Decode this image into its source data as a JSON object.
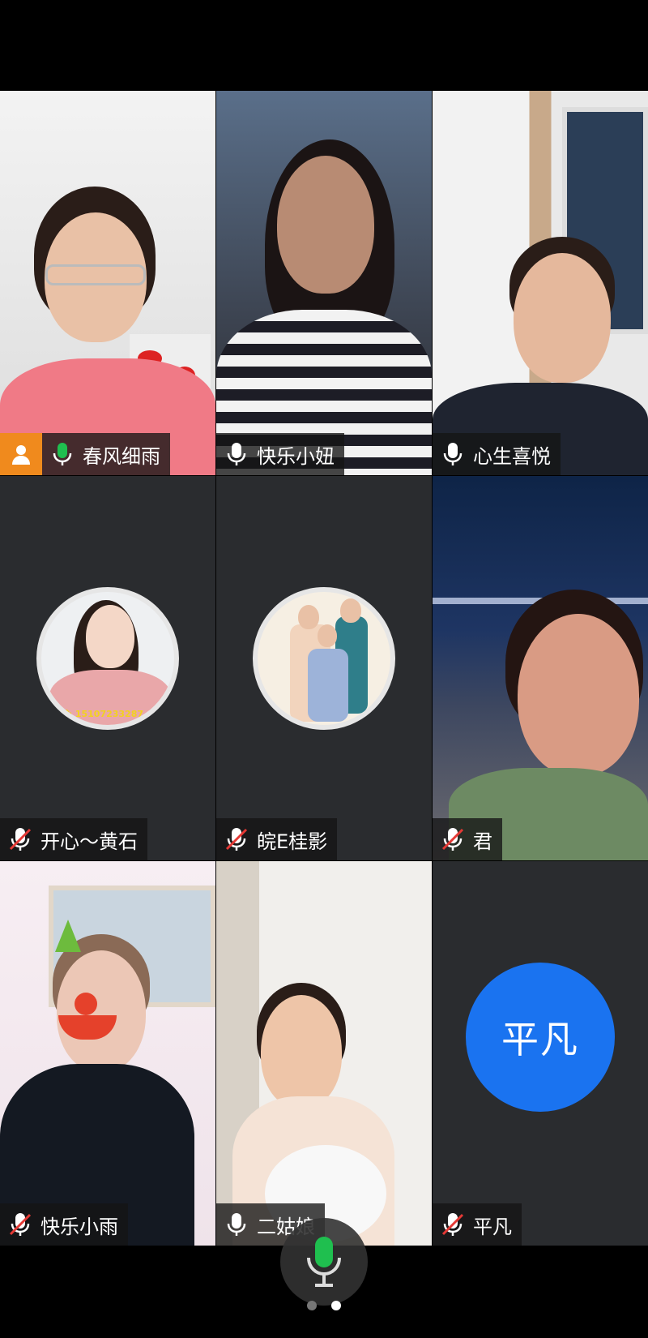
{
  "participants": [
    {
      "name": "春风细雨",
      "muted": false,
      "host": true
    },
    {
      "name": "快乐小妞",
      "muted": false
    },
    {
      "name": "心生喜悦",
      "muted": false
    },
    {
      "name": "开心～黄石",
      "muted": true
    },
    {
      "name": "皖E桂影",
      "muted": true
    },
    {
      "name": "君",
      "muted": true
    },
    {
      "name": "快乐小雨",
      "muted": true
    },
    {
      "name": "二姑娘",
      "muted": false
    },
    {
      "name": "平凡",
      "muted": true,
      "avatar_text": "平凡"
    }
  ],
  "avatar_overlay_text": "开心 15107233287",
  "pager": {
    "pages": 2,
    "current": 2
  },
  "colors": {
    "active_border": "#1fbf4f",
    "host_badge": "#f08a1d",
    "avatar_blue": "#1a73f0",
    "mic_active": "#1fbf4f",
    "mic_muted": "#e53935"
  }
}
